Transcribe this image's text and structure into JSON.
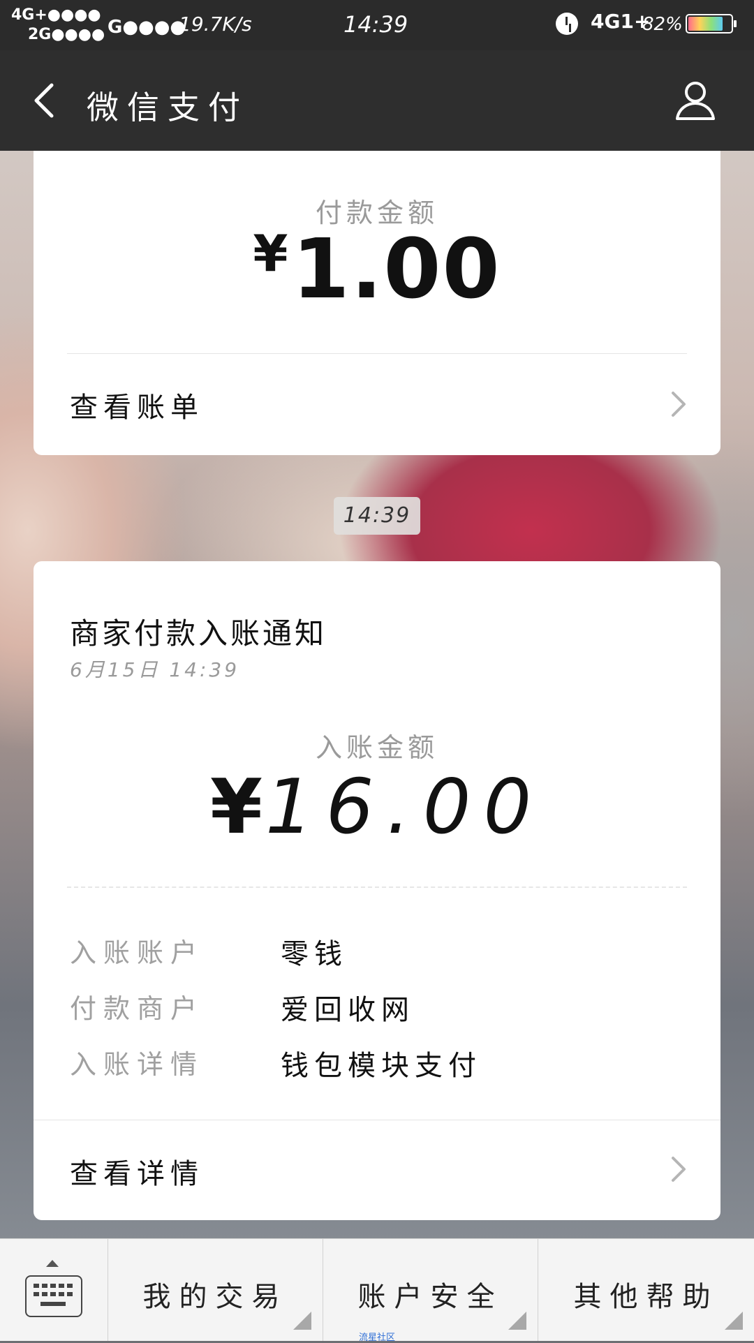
{
  "status_bar": {
    "network_left_top": "4G+●●●●",
    "network_left_bottom": "2G●●●●",
    "network_g": "G●●●●",
    "speed": "19.7K/s",
    "time": "14:39",
    "network_right": "4G1+",
    "battery_percent": "82%",
    "battery_level": 0.82
  },
  "nav": {
    "title": "微信支付",
    "back_icon": "chevron-left-icon",
    "user_icon": "user-icon"
  },
  "payment_card": {
    "label": "付款金额",
    "currency": "¥",
    "amount": "1.00",
    "link": "查看账单"
  },
  "time_chip": "14:39",
  "notice_card": {
    "title": "商家付款入账通知",
    "date": "6月15日  14:39",
    "amount_label": "入账金额",
    "currency": "¥",
    "amount": "16.00",
    "details": [
      {
        "key": "入账账户",
        "value": "零钱"
      },
      {
        "key": "付款商户",
        "value": "爱回收网"
      },
      {
        "key": "入账详情",
        "value": "钱包模块支付"
      }
    ],
    "link": "查看详情"
  },
  "bottom_menu": {
    "keyboard_icon": "keyboard-icon",
    "items": [
      "我的交易",
      "账户安全",
      "其他帮助"
    ],
    "watermark": "流星社区"
  },
  "colors": {
    "nav_bg": "#2e2e2e",
    "status_bg": "#2b2b2b",
    "card_bg": "#ffffff",
    "muted_text": "#9a9a9a"
  }
}
